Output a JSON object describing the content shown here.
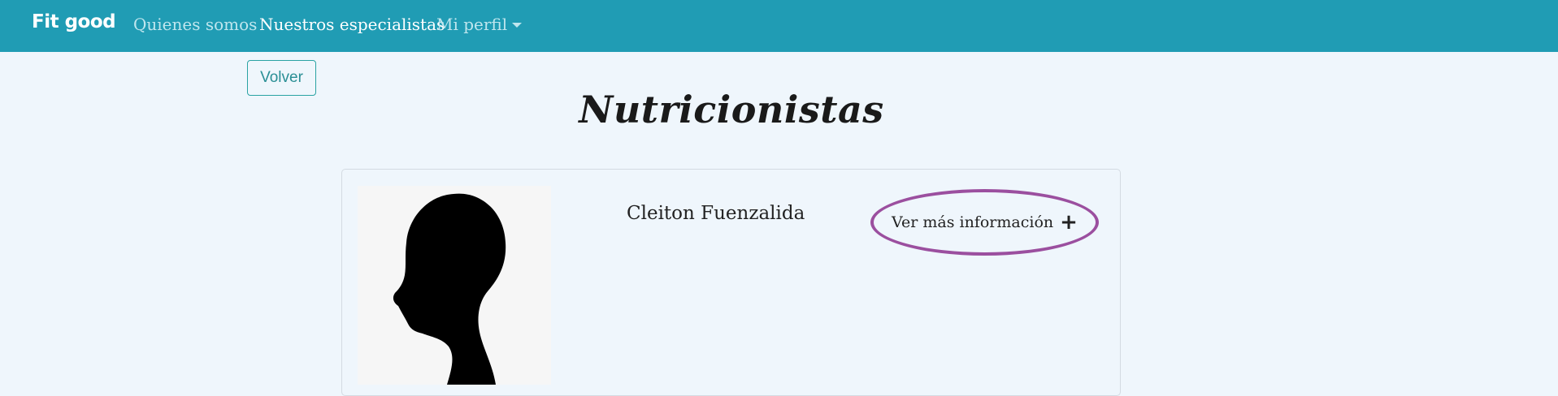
{
  "navbar": {
    "brand": "Fit good",
    "links": [
      {
        "label": "Quienes somos"
      },
      {
        "label": "Nuestros especialistas"
      },
      {
        "label": "Mi perfil"
      }
    ]
  },
  "back_button": {
    "label": "Volver"
  },
  "page_title": "Nutricionistas",
  "specialist": {
    "name": "Cleiton Fuenzalida",
    "more_info_label": "Ver más información"
  },
  "colors": {
    "navbar_bg": "#209cb4",
    "page_bg": "#eff6fc",
    "highlight_ellipse": "#9b4f9f",
    "outline_button": "#2aa3a3"
  }
}
